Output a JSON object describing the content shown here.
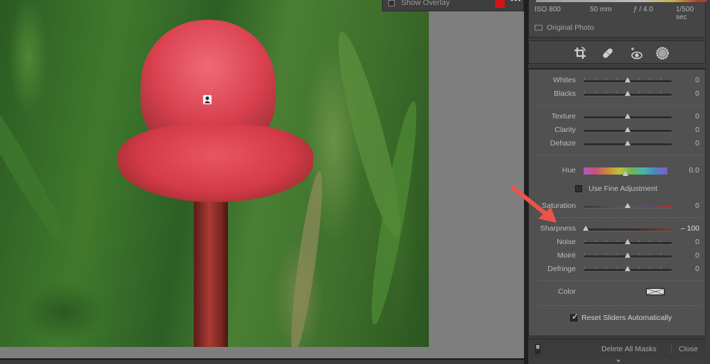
{
  "overlay": {
    "show_overlay_label": "Show Overlay",
    "show_overlay_checked": false,
    "overlay_color": "#d4141b",
    "more_icon": "more-dots-icon",
    "more_label": "•••"
  },
  "info": {
    "iso": "ISO 800",
    "focal_length": "50 mm",
    "aperture": "ƒ / 4.0",
    "shutter": "1/500 sec",
    "original_photo_label": "Original Photo",
    "original_photo_checked": false
  },
  "tools": [
    {
      "name": "crop-icon"
    },
    {
      "name": "healing-icon"
    },
    {
      "name": "red-eye-icon"
    },
    {
      "name": "masking-icon"
    }
  ],
  "mask_panel": {
    "sliders_group1": [
      {
        "label": "Whites",
        "value": "0",
        "position": 0.5
      },
      {
        "label": "Blacks",
        "value": "0",
        "position": 0.5
      }
    ],
    "sliders_group2": [
      {
        "label": "Texture",
        "value": "0",
        "position": 0.5
      },
      {
        "label": "Clarity",
        "value": "0",
        "position": 0.5
      },
      {
        "label": "Dehaze",
        "value": "0",
        "position": 0.5
      }
    ],
    "hue": {
      "label": "Hue",
      "value": "0.0",
      "position": 0.5
    },
    "fine_adjustment": {
      "label": "Use Fine Adjustment",
      "checked": false
    },
    "saturation": {
      "label": "Saturation",
      "value": "0",
      "position": 0.5
    },
    "sliders_group3": [
      {
        "label": "Sharpness",
        "value": "– 100",
        "position": 0.0
      },
      {
        "label": "Noise",
        "value": "0",
        "position": 0.5
      },
      {
        "label": "Moiré",
        "value": "0",
        "position": 0.5
      },
      {
        "label": "Defringe",
        "value": "0",
        "position": 0.5
      }
    ],
    "color_label": "Color",
    "reset_label": "Reset Sliders Automatically",
    "reset_checked": true,
    "reset_check_glyph": "✓"
  },
  "footer": {
    "delete_all_masks": "Delete All Masks",
    "close": "Close"
  },
  "annotation": {
    "arrow_color": "#f0524a",
    "points_to": "Sharpness"
  }
}
